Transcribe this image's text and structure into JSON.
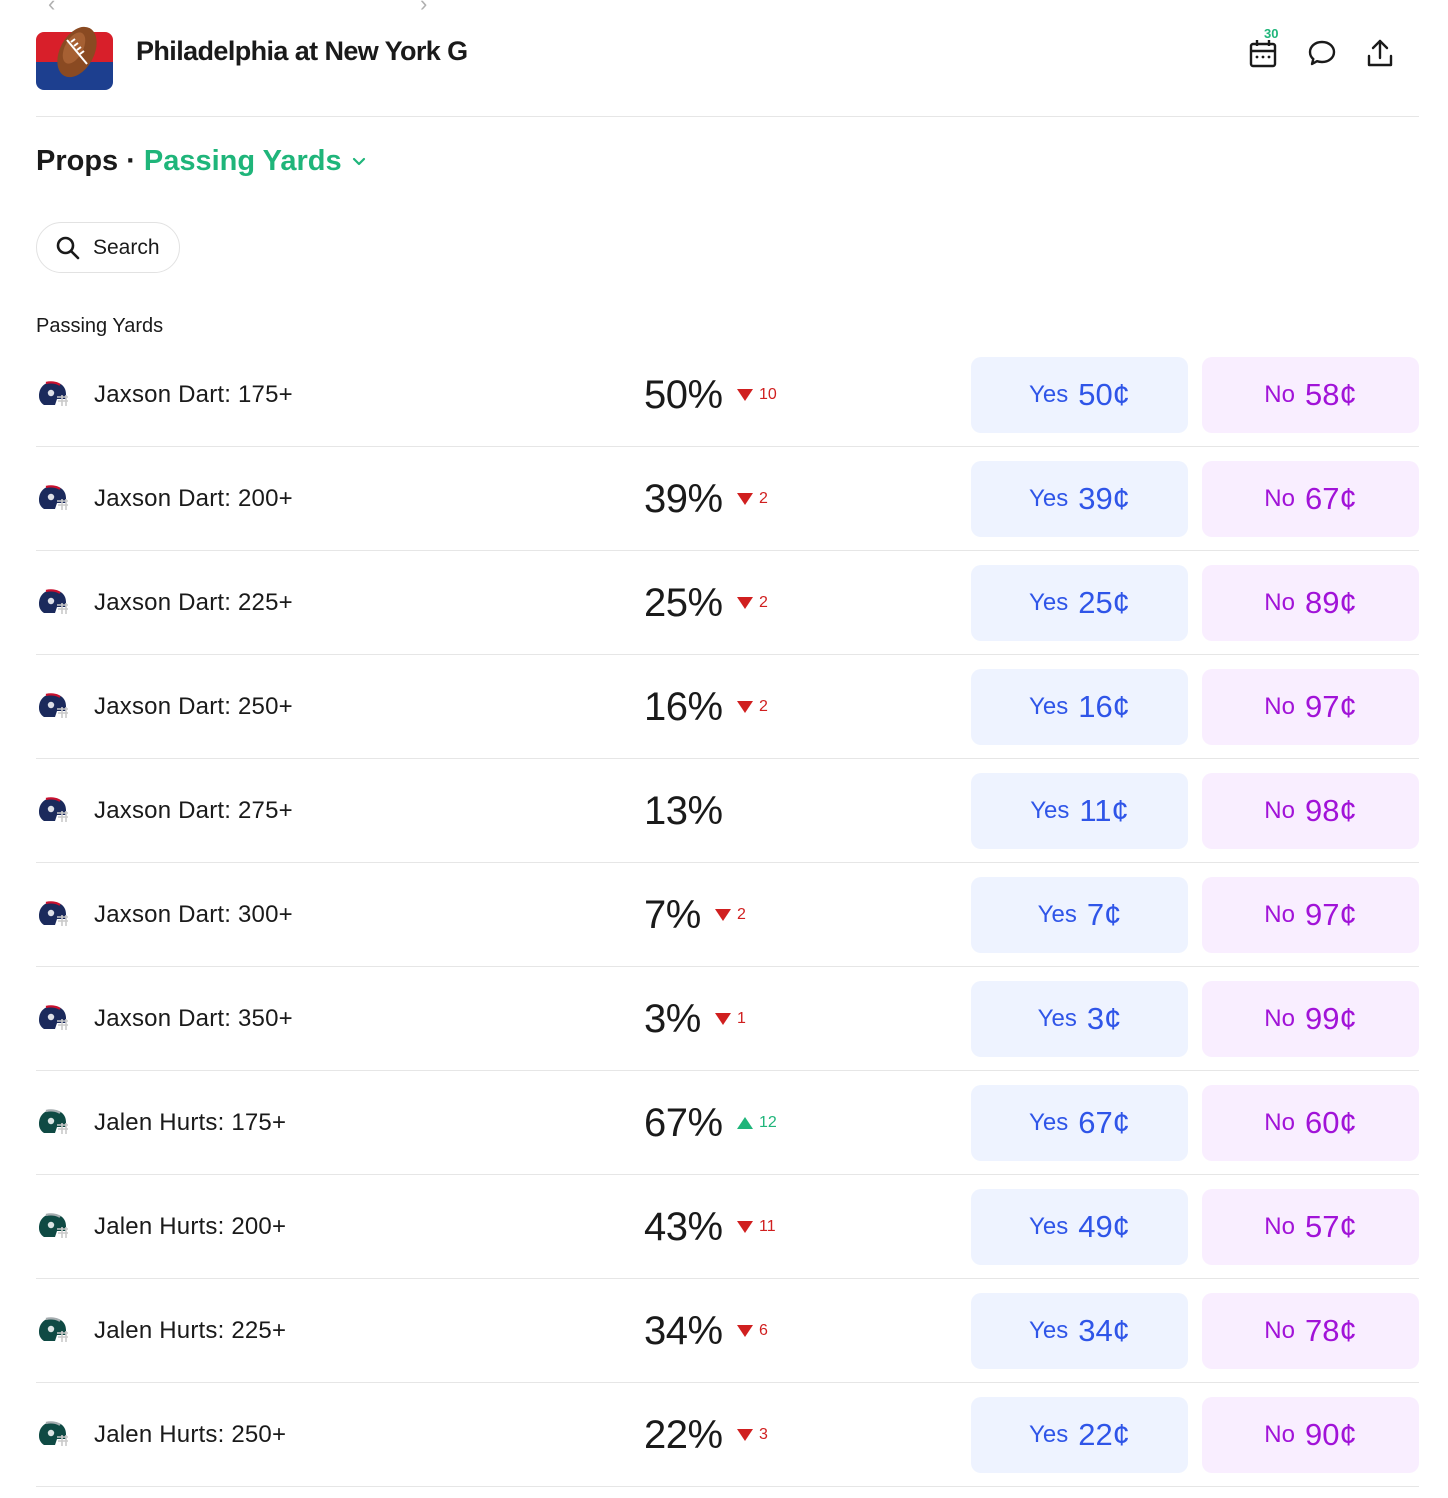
{
  "header": {
    "title": "Philadelphia at New York G",
    "calendar_badge": "30"
  },
  "props": {
    "label": "Props",
    "separator": "·",
    "selected": "Passing Yards"
  },
  "search": {
    "label": "Search"
  },
  "section": {
    "title": "Passing Yards"
  },
  "colors": {
    "accent_green": "#1fb57a",
    "down_red": "#d01f1f",
    "yes_text": "#2f55e8",
    "yes_bg": "#eef3ff",
    "no_text": "#a113d8",
    "no_bg": "#f9eeff"
  },
  "rows": [
    {
      "player": "Jaxson Dart: 175+",
      "team": "giants",
      "pct": "50%",
      "dir": "down",
      "delta": "10",
      "yes_label": "Yes",
      "yes_price": "50¢",
      "no_label": "No",
      "no_price": "58¢"
    },
    {
      "player": "Jaxson Dart: 200+",
      "team": "giants",
      "pct": "39%",
      "dir": "down",
      "delta": "2",
      "yes_label": "Yes",
      "yes_price": "39¢",
      "no_label": "No",
      "no_price": "67¢"
    },
    {
      "player": "Jaxson Dart: 225+",
      "team": "giants",
      "pct": "25%",
      "dir": "down",
      "delta": "2",
      "yes_label": "Yes",
      "yes_price": "25¢",
      "no_label": "No",
      "no_price": "89¢"
    },
    {
      "player": "Jaxson Dart: 250+",
      "team": "giants",
      "pct": "16%",
      "dir": "down",
      "delta": "2",
      "yes_label": "Yes",
      "yes_price": "16¢",
      "no_label": "No",
      "no_price": "97¢"
    },
    {
      "player": "Jaxson Dart: 275+",
      "team": "giants",
      "pct": "13%",
      "dir": "none",
      "delta": "",
      "yes_label": "Yes",
      "yes_price": "11¢",
      "no_label": "No",
      "no_price": "98¢"
    },
    {
      "player": "Jaxson Dart: 300+",
      "team": "giants",
      "pct": "7%",
      "dir": "down",
      "delta": "2",
      "yes_label": "Yes",
      "yes_price": "7¢",
      "no_label": "No",
      "no_price": "97¢"
    },
    {
      "player": "Jaxson Dart: 350+",
      "team": "giants",
      "pct": "3%",
      "dir": "down",
      "delta": "1",
      "yes_label": "Yes",
      "yes_price": "3¢",
      "no_label": "No",
      "no_price": "99¢"
    },
    {
      "player": "Jalen Hurts: 175+",
      "team": "eagles",
      "pct": "67%",
      "dir": "up",
      "delta": "12",
      "yes_label": "Yes",
      "yes_price": "67¢",
      "no_label": "No",
      "no_price": "60¢"
    },
    {
      "player": "Jalen Hurts: 200+",
      "team": "eagles",
      "pct": "43%",
      "dir": "down",
      "delta": "11",
      "yes_label": "Yes",
      "yes_price": "49¢",
      "no_label": "No",
      "no_price": "57¢"
    },
    {
      "player": "Jalen Hurts: 225+",
      "team": "eagles",
      "pct": "34%",
      "dir": "down",
      "delta": "6",
      "yes_label": "Yes",
      "yes_price": "34¢",
      "no_label": "No",
      "no_price": "78¢"
    },
    {
      "player": "Jalen Hurts: 250+",
      "team": "eagles",
      "pct": "22%",
      "dir": "down",
      "delta": "3",
      "yes_label": "Yes",
      "yes_price": "22¢",
      "no_label": "No",
      "no_price": "90¢"
    }
  ]
}
